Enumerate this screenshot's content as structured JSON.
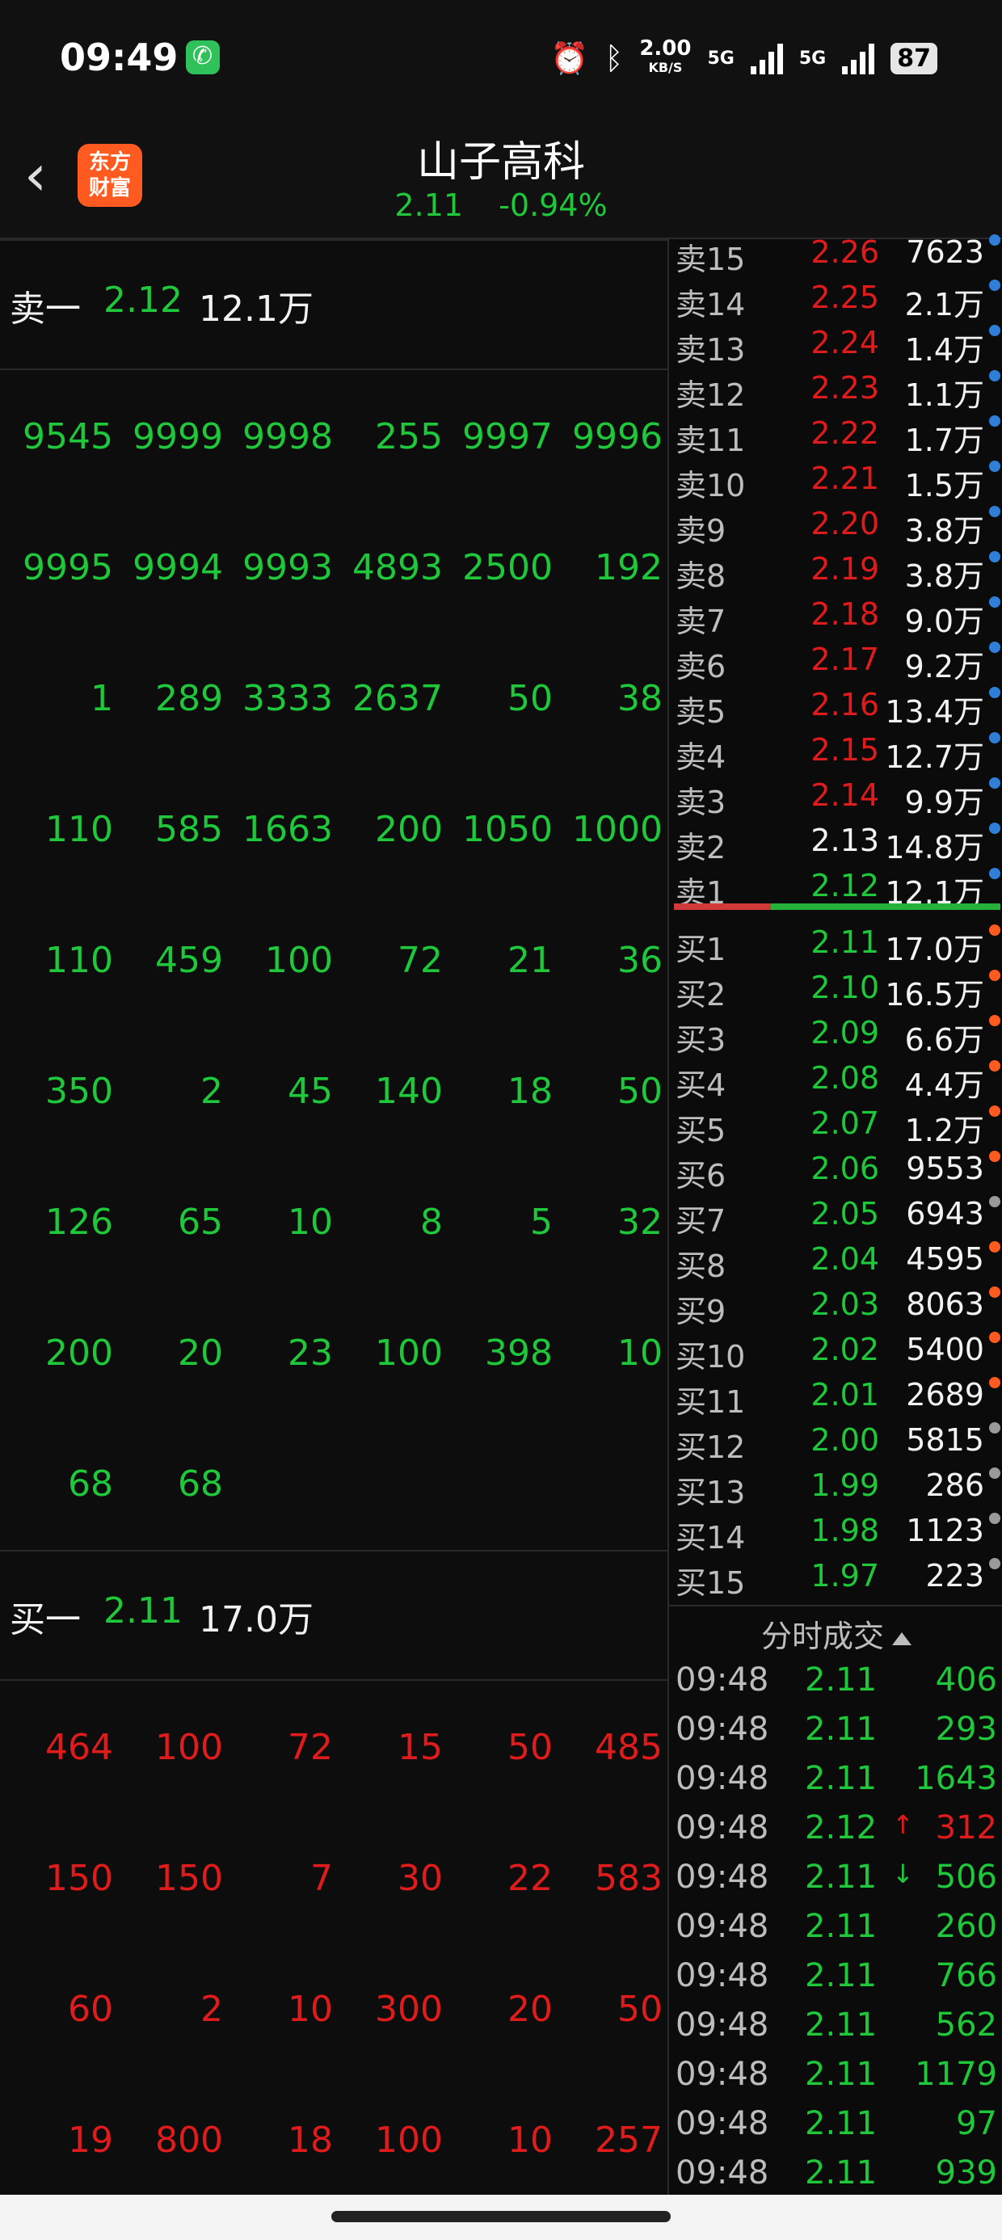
{
  "statusbar": {
    "time": "09:49",
    "speed": "2.00",
    "speed_unit": "KB/S",
    "sig1": "5G",
    "sig2": "5G",
    "battery": "87"
  },
  "header": {
    "title": "山子高科",
    "price": "2.11",
    "change": "-0.94%",
    "logo_line1": "东方",
    "logo_line2": "财富"
  },
  "sell1": {
    "label": "卖一",
    "price": "2.12",
    "volume": "12.1万"
  },
  "buy1": {
    "label": "买一",
    "price": "2.11",
    "volume": "17.0万"
  },
  "sell_orders": [
    [
      "9545",
      "9999",
      "9998",
      "255",
      "9997",
      "9996"
    ],
    [
      "9995",
      "9994",
      "9993",
      "4893",
      "2500",
      "192"
    ],
    [
      "1",
      "289",
      "3333",
      "2637",
      "50",
      "38"
    ],
    [
      "110",
      "585",
      "1663",
      "200",
      "1050",
      "1000"
    ],
    [
      "110",
      "459",
      "100",
      "72",
      "21",
      "36"
    ],
    [
      "350",
      "2",
      "45",
      "140",
      "18",
      "50"
    ],
    [
      "126",
      "65",
      "10",
      "8",
      "5",
      "32"
    ],
    [
      "200",
      "20",
      "23",
      "100",
      "398",
      "10"
    ],
    [
      "68",
      "68",
      "",
      "",
      "",
      ""
    ]
  ],
  "buy_orders": [
    [
      "464",
      "100",
      "72",
      "15",
      "50",
      "485"
    ],
    [
      "150",
      "150",
      "7",
      "30",
      "22",
      "583"
    ],
    [
      "60",
      "2",
      "10",
      "300",
      "20",
      "50"
    ],
    [
      "19",
      "800",
      "18",
      "100",
      "10",
      "257"
    ]
  ],
  "sell_book": [
    {
      "name": "卖15",
      "price": "2.26",
      "volume": "7623",
      "price_color": "red",
      "dot": "blue"
    },
    {
      "name": "卖14",
      "price": "2.25",
      "volume": "2.1万",
      "price_color": "red",
      "dot": "blue"
    },
    {
      "name": "卖13",
      "price": "2.24",
      "volume": "1.4万",
      "price_color": "red",
      "dot": "blue"
    },
    {
      "name": "卖12",
      "price": "2.23",
      "volume": "1.1万",
      "price_color": "red",
      "dot": "blue"
    },
    {
      "name": "卖11",
      "price": "2.22",
      "volume": "1.7万",
      "price_color": "red",
      "dot": "blue"
    },
    {
      "name": "卖10",
      "price": "2.21",
      "volume": "1.5万",
      "price_color": "red",
      "dot": "blue"
    },
    {
      "name": "卖9",
      "price": "2.20",
      "volume": "3.8万",
      "price_color": "red",
      "dot": "blue"
    },
    {
      "name": "卖8",
      "price": "2.19",
      "volume": "3.8万",
      "price_color": "red",
      "dot": "blue"
    },
    {
      "name": "卖7",
      "price": "2.18",
      "volume": "9.0万",
      "price_color": "red",
      "dot": "blue"
    },
    {
      "name": "卖6",
      "price": "2.17",
      "volume": "9.2万",
      "price_color": "red",
      "dot": "blue"
    },
    {
      "name": "卖5",
      "price": "2.16",
      "volume": "13.4万",
      "price_color": "red",
      "dot": "blue"
    },
    {
      "name": "卖4",
      "price": "2.15",
      "volume": "12.7万",
      "price_color": "red",
      "dot": "blue"
    },
    {
      "name": "卖3",
      "price": "2.14",
      "volume": "9.9万",
      "price_color": "red",
      "dot": "blue"
    },
    {
      "name": "卖2",
      "price": "2.13",
      "volume": "14.8万",
      "price_color": "white",
      "dot": "blue"
    },
    {
      "name": "卖1",
      "price": "2.12",
      "volume": "12.1万",
      "price_color": "green",
      "dot": "blue"
    }
  ],
  "buy_book": [
    {
      "name": "买1",
      "price": "2.11",
      "volume": "17.0万",
      "dot": "orange"
    },
    {
      "name": "买2",
      "price": "2.10",
      "volume": "16.5万",
      "dot": "orange"
    },
    {
      "name": "买3",
      "price": "2.09",
      "volume": "6.6万",
      "dot": "orange"
    },
    {
      "name": "买4",
      "price": "2.08",
      "volume": "4.4万",
      "dot": "orange"
    },
    {
      "name": "买5",
      "price": "2.07",
      "volume": "1.2万",
      "dot": "orange"
    },
    {
      "name": "买6",
      "price": "2.06",
      "volume": "9553",
      "dot": "orange"
    },
    {
      "name": "买7",
      "price": "2.05",
      "volume": "6943",
      "dot": "grey"
    },
    {
      "name": "买8",
      "price": "2.04",
      "volume": "4595",
      "dot": "orange"
    },
    {
      "name": "买9",
      "price": "2.03",
      "volume": "8063",
      "dot": "orange"
    },
    {
      "name": "买10",
      "price": "2.02",
      "volume": "5400",
      "dot": "orange"
    },
    {
      "name": "买11",
      "price": "2.01",
      "volume": "2689",
      "dot": "orange"
    },
    {
      "name": "买12",
      "price": "2.00",
      "volume": "5815",
      "dot": "grey"
    },
    {
      "name": "买13",
      "price": "1.99",
      "volume": "286",
      "dot": "grey"
    },
    {
      "name": "买14",
      "price": "1.98",
      "volume": "1123",
      "dot": "grey"
    },
    {
      "name": "买15",
      "price": "1.97",
      "volume": "223",
      "dot": "grey"
    }
  ],
  "trades_title": "分时成交",
  "trades": [
    {
      "time": "09:48",
      "price": "2.11",
      "arrow": "",
      "volume": "406",
      "vol_color": "green"
    },
    {
      "time": "09:48",
      "price": "2.11",
      "arrow": "",
      "volume": "293",
      "vol_color": "green"
    },
    {
      "time": "09:48",
      "price": "2.11",
      "arrow": "",
      "volume": "1643",
      "vol_color": "green"
    },
    {
      "time": "09:48",
      "price": "2.12",
      "arrow": "↑",
      "volume": "312",
      "vol_color": "red"
    },
    {
      "time": "09:48",
      "price": "2.11",
      "arrow": "↓",
      "volume": "506",
      "vol_color": "green"
    },
    {
      "time": "09:48",
      "price": "2.11",
      "arrow": "",
      "volume": "260",
      "vol_color": "green"
    },
    {
      "time": "09:48",
      "price": "2.11",
      "arrow": "",
      "volume": "766",
      "vol_color": "green"
    },
    {
      "time": "09:48",
      "price": "2.11",
      "arrow": "",
      "volume": "562",
      "vol_color": "green"
    },
    {
      "time": "09:48",
      "price": "2.11",
      "arrow": "",
      "volume": "1179",
      "vol_color": "green"
    },
    {
      "time": "09:48",
      "price": "2.11",
      "arrow": "",
      "volume": "97",
      "vol_color": "green"
    },
    {
      "time": "09:48",
      "price": "2.11",
      "arrow": "",
      "volume": "939",
      "vol_color": "green"
    }
  ]
}
